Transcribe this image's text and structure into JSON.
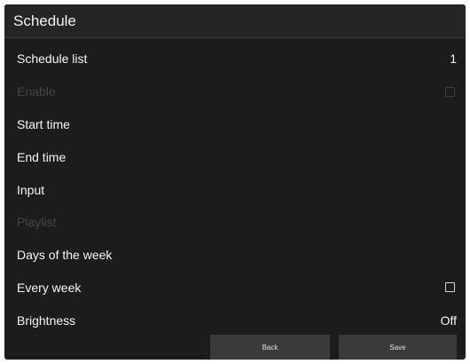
{
  "header": {
    "title": "Schedule"
  },
  "rows": [
    {
      "label": "Schedule list",
      "value": "1"
    },
    {
      "label": "Enable"
    },
    {
      "label": "Start time"
    },
    {
      "label": "End time"
    },
    {
      "label": "Input"
    },
    {
      "label": "Playlist"
    },
    {
      "label": "Days of the week"
    },
    {
      "label": "Every week"
    },
    {
      "label": "Brightness",
      "value": "Off"
    }
  ],
  "state": {
    "enable_checked": false,
    "enable_disabled": true,
    "playlist_disabled": true,
    "every_week_checked": false
  },
  "footer": {
    "back_label": "Back",
    "save_label": "Save"
  },
  "colors": {
    "background": "#1c1c1c",
    "disabled_text": "#454545",
    "button": "#3a3a3a"
  }
}
